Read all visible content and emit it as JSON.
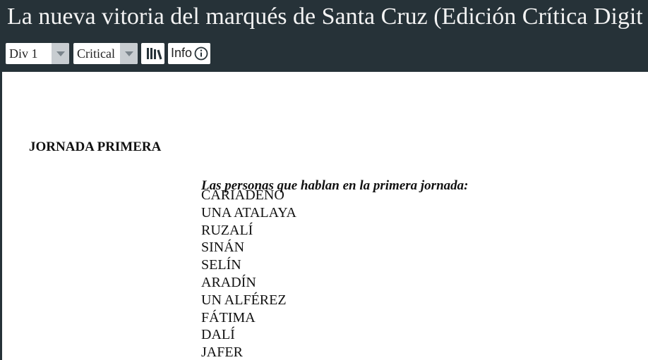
{
  "header": {
    "title": "La nueva vitoria del marqués de Santa Cruz (Edición Crítica Digital)"
  },
  "toolbar": {
    "division_select": {
      "value": "Div 1"
    },
    "edition_select": {
      "value": "Critical"
    },
    "library_button_icon": "library-books-icon",
    "info_button": {
      "label": "Info",
      "icon": "info-circle-icon"
    }
  },
  "content": {
    "jornada_heading": "JORNADA PRIMERA",
    "persons_heading": "Las personas que hablan en la primera jornada:",
    "persons": [
      "CARIADENO",
      "UNA ATALAYA",
      "RUZALÍ",
      "SINÁN",
      "SELÍN",
      "ARADÍN",
      "UN ALFÉREZ",
      "FÁTIMA",
      "DALÍ",
      "JAFER"
    ]
  },
  "colors": {
    "header_background": "#263238",
    "content_background": "#ffffff",
    "header_text": "#f3f3f3",
    "select_arrow_background": "#c8cdd1"
  }
}
